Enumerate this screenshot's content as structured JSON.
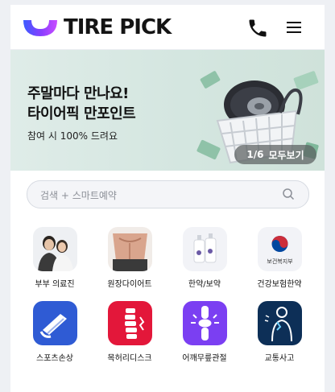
{
  "brand": {
    "name": "TIRE PICK"
  },
  "header": {
    "phone_icon": "phone-icon",
    "menu_icon": "hamburger-menu-icon"
  },
  "banner": {
    "title_line1": "주말마다 만나요!",
    "title_line2": "타이어픽 만포인트",
    "subtitle": "참여 시 100% 드려요",
    "pager": "1/6",
    "more_label": "모두보기",
    "background": "#d6e8e2"
  },
  "search": {
    "placeholder": "검색 + 스마트예약",
    "icon": "search-icon"
  },
  "categories": [
    {
      "label": "부부 의료진",
      "icon": "doctors-photo"
    },
    {
      "label": "원장다이어트",
      "icon": "body-photo"
    },
    {
      "label": "한약/보약",
      "icon": "herbal-medicine-icon"
    },
    {
      "label": "건강보험한약",
      "icon": "health-ministry-logo",
      "logo_text": "보건복지부"
    },
    {
      "label": "스포츠손상",
      "icon": "sports-injury-icon",
      "color": "#2f5bd4"
    },
    {
      "label": "목허리디스크",
      "icon": "spine-icon",
      "color": "#e3173a"
    },
    {
      "label": "어깨무릎관절",
      "icon": "joint-icon",
      "color": "#7b3ff2"
    },
    {
      "label": "교통사고",
      "icon": "accident-icon",
      "color": "#0d2f57"
    }
  ]
}
